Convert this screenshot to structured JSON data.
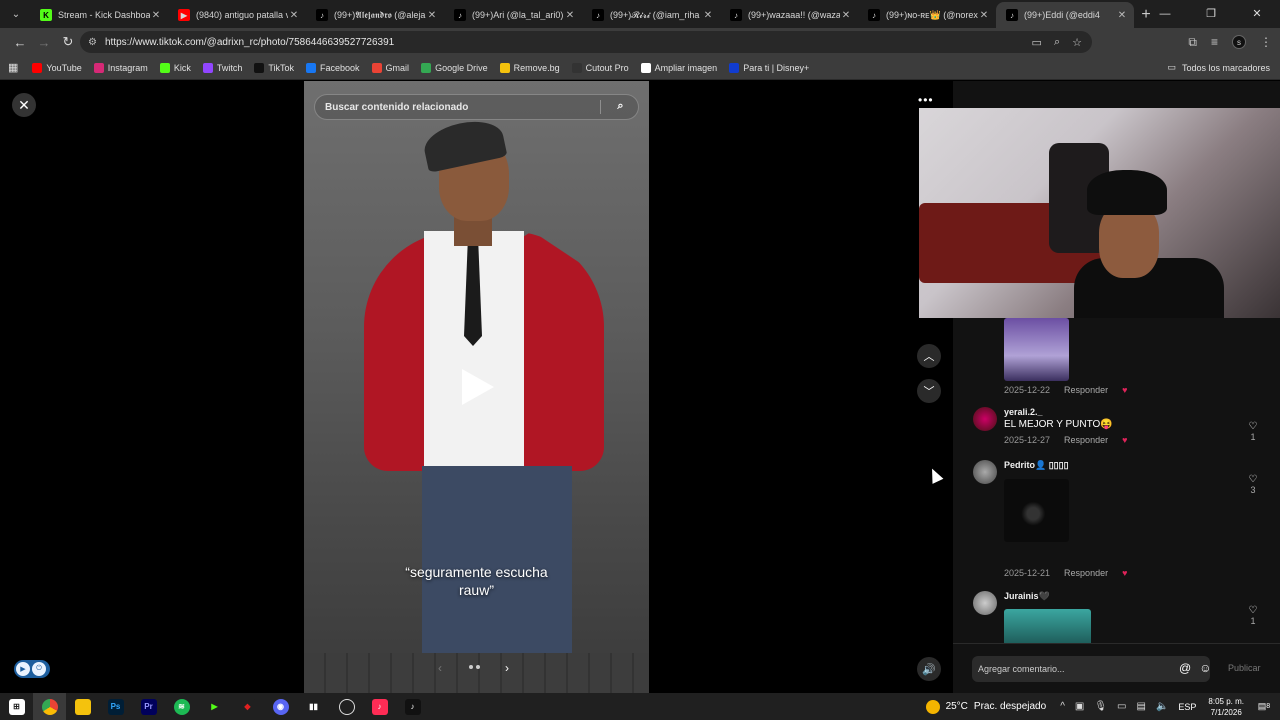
{
  "browser": {
    "tabs": [
      {
        "title": "Stream - Kick Dashboard",
        "favicon": "kick-icon",
        "color": "#53fc18",
        "active": false
      },
      {
        "title": "(9840) antiguo patalla ve",
        "favicon": "youtube-icon",
        "color": "#ff0000",
        "active": false
      },
      {
        "title": "(99+)𝕬𝖑𝖊𝖏𝖆𝖓𝖉𝖗𝖔 (@alejan",
        "favicon": "tiktok-icon",
        "color": "#000000",
        "active": false
      },
      {
        "title": "(99+)Ari (@la_tal_ari0) |",
        "favicon": "tiktok-icon",
        "color": "#000000",
        "active": false
      },
      {
        "title": "(99+)𝓡𝓲𝓻𝓲 (@iam_riha",
        "favicon": "tiktok-icon",
        "color": "#000000",
        "active": false
      },
      {
        "title": "(99+)wazaaa!! (@wazaa",
        "favicon": "tiktok-icon",
        "color": "#000000",
        "active": false
      },
      {
        "title": "(99+)ɴᴏ-ʀᴇ👑 (@norexo",
        "favicon": "tiktok-icon",
        "color": "#000000",
        "active": false
      },
      {
        "title": "(99+)Eddi (@eddi4",
        "favicon": "tiktok-icon",
        "color": "#000000",
        "active": true
      }
    ],
    "url": "https://www.tiktok.com/@adrixn_rc/photo/7586446639527726391",
    "bookmarks": [
      {
        "label": "YouTube",
        "icon": "youtube-icon",
        "color": "#ff0000"
      },
      {
        "label": "Instagram",
        "icon": "instagram-icon",
        "color": "#d62976"
      },
      {
        "label": "Kick",
        "icon": "kick-icon",
        "color": "#53fc18"
      },
      {
        "label": "Twitch",
        "icon": "twitch-icon",
        "color": "#9146ff"
      },
      {
        "label": "TikTok",
        "icon": "tiktok-icon",
        "color": "#111111"
      },
      {
        "label": "Facebook",
        "icon": "facebook-icon",
        "color": "#1877f2"
      },
      {
        "label": "Gmail",
        "icon": "gmail-icon",
        "color": "#ea4335"
      },
      {
        "label": "Google Drive",
        "icon": "drive-icon",
        "color": "#34a853"
      },
      {
        "label": "Remove.bg",
        "icon": "removebg-icon",
        "color": "#f4c20d"
      },
      {
        "label": "Cutout Pro",
        "icon": "cutout-icon",
        "color": "#333333"
      },
      {
        "label": "Ampliar imagen",
        "icon": "ampliar-icon",
        "color": "#ffffff"
      },
      {
        "label": "Para ti | Disney+",
        "icon": "disney-icon",
        "color": "#113ccf"
      }
    ],
    "all_bookmarks": "Todos los marcadores"
  },
  "post": {
    "search_placeholder": "Buscar contenido relacionado",
    "caption_line1": "“seguramente escucha",
    "caption_line2": "rauw”"
  },
  "comments": [
    {
      "meta_date": "2025-12-22",
      "reply": "Responder"
    },
    {
      "user": "yerali.2._",
      "text": "EL MEJOR Y PUNTO😝",
      "date": "2025-12-27",
      "reply": "Responder",
      "likes": "1"
    },
    {
      "user": "Pedrito👤 ▯▯▯▯",
      "date": "2025-12-21",
      "reply": "Responder",
      "likes": "3"
    },
    {
      "user": "Jurainis🖤",
      "likes": "1"
    }
  ],
  "comment_box": {
    "placeholder": "Agregar comentario...",
    "publish": "Publicar"
  },
  "taskbar": {
    "weather_temp": "25°C",
    "weather_desc": "Prac. despejado",
    "lang": "ESP",
    "time": "8:05 p. m.",
    "date": "7/1/2026",
    "notif_count": "8"
  }
}
